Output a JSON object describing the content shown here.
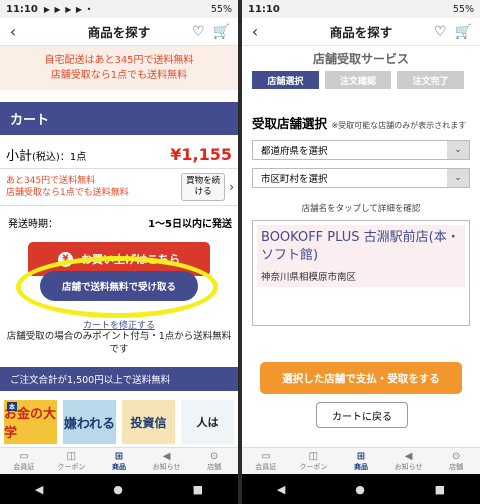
{
  "left": {
    "status": {
      "time": "11:10",
      "icons": "▶ ▶ ▶ ▶ •",
      "battery": "55%"
    },
    "header": {
      "title": "商品を探す"
    },
    "banner": {
      "line1": "自宅配送はあと345円で送料無料",
      "line2": "店舗受取なら1点でも送料無料"
    },
    "cart_title": "カート",
    "subtotal": {
      "label": "小計",
      "tax": "(税込)",
      "count": "：1点",
      "price": "¥1,155"
    },
    "notice": {
      "line1": "あと345円で送料無料",
      "line2": "店舗受取なら1点でも送料無料"
    },
    "continue_btn": {
      "line1": "買物を続",
      "line2": "ける"
    },
    "shipping": {
      "label": "発送時期：",
      "value": "1〜5日以内に発送"
    },
    "buy_btn": "お買い上げはこちら",
    "store_btn": "店舗で送料無料で受け取る",
    "link_text": "カートを修正する",
    "point_note": "店舗受取の場合のみポイント付与・1点から送料無料です",
    "free_bar": "ご注文合計が1,500円以上で送料無料",
    "books": [
      "お金の大学",
      "嫌われる",
      "投資信",
      "人は"
    ]
  },
  "right": {
    "status": {
      "time": "11:10",
      "battery": "55%"
    },
    "header": {
      "title": "商品を探す"
    },
    "service_title": "店舗受取サービス",
    "steps": [
      "店舗選択",
      "注文確認",
      "注文完了"
    ],
    "section_title": "受取店舗選択",
    "section_note": "※受取可能な店舗のみが表示されます",
    "prefecture_select": "都道府県を選択",
    "city_select": "市区町村を選択",
    "tap_note": "店舗名をタップして詳細を確認",
    "store": {
      "name": "BOOKOFF PLUS 古淵駅前店(本・ソフト館)",
      "address": "神奈川県相模原市南区"
    },
    "pay_btn": "選択した店舗で支払・受取をする",
    "back_btn": "カートに戻る"
  },
  "tabs": [
    "会員証",
    "クーポン",
    "商品",
    "お知らせ",
    "店舗"
  ],
  "colors": {
    "navy": "#424c8e",
    "red": "#d8392b",
    "orange": "#f2962e",
    "highlight": "#f4ee1a"
  }
}
